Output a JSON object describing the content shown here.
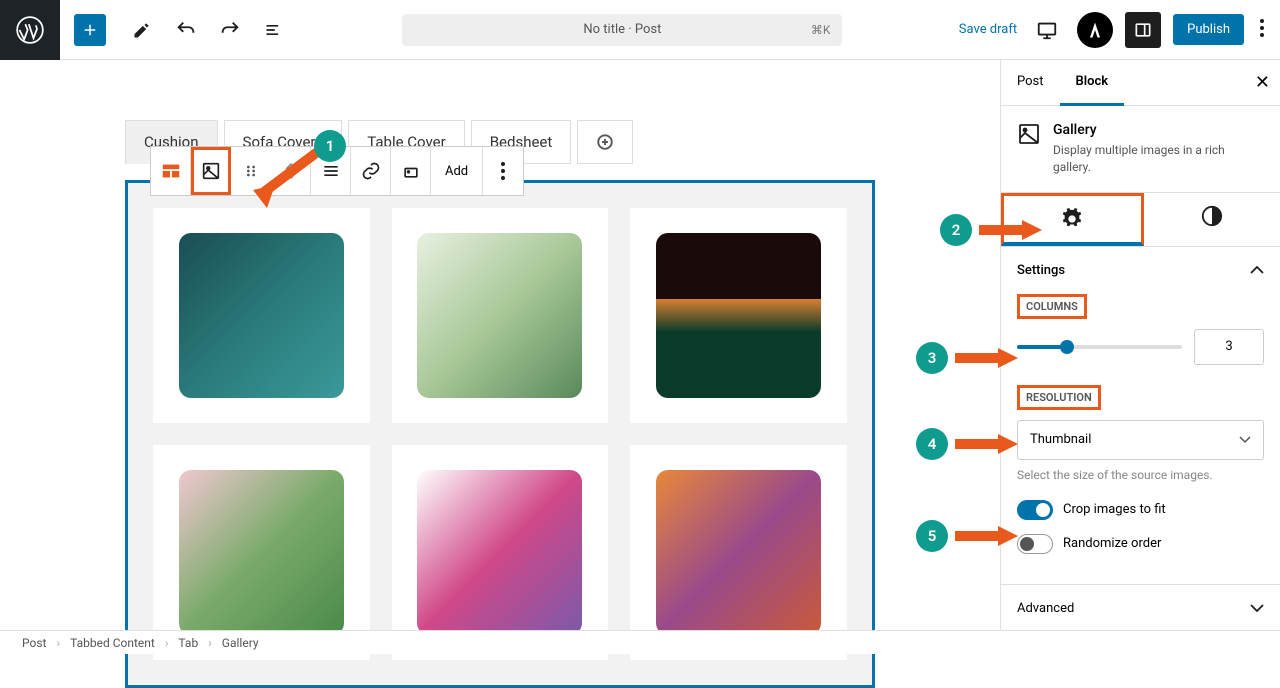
{
  "topbar": {
    "title": "No title · Post",
    "shortcut": "⌘K",
    "save_draft": "Save draft",
    "publish": "Publish"
  },
  "tabs": [
    "Cushion",
    "Sofa Covers",
    "Table Cover",
    "Bedsheet"
  ],
  "toolbar": {
    "add_label": "Add"
  },
  "sidebar": {
    "tab_post": "Post",
    "tab_block": "Block",
    "block_name": "Gallery",
    "block_desc": "Display multiple images in a rich gallery.",
    "settings_panel": "Settings",
    "columns_label": "COLUMNS",
    "columns_value": "3",
    "resolution_label": "RESOLUTION",
    "resolution_value": "Thumbnail",
    "resolution_help": "Select the size of the source images.",
    "crop_label": "Crop images to fit",
    "randomize_label": "Randomize order",
    "advanced_label": "Advanced"
  },
  "breadcrumb": [
    "Post",
    "Tabbed Content",
    "Tab",
    "Gallery"
  ],
  "annotations": [
    "1",
    "2",
    "3",
    "4",
    "5"
  ]
}
